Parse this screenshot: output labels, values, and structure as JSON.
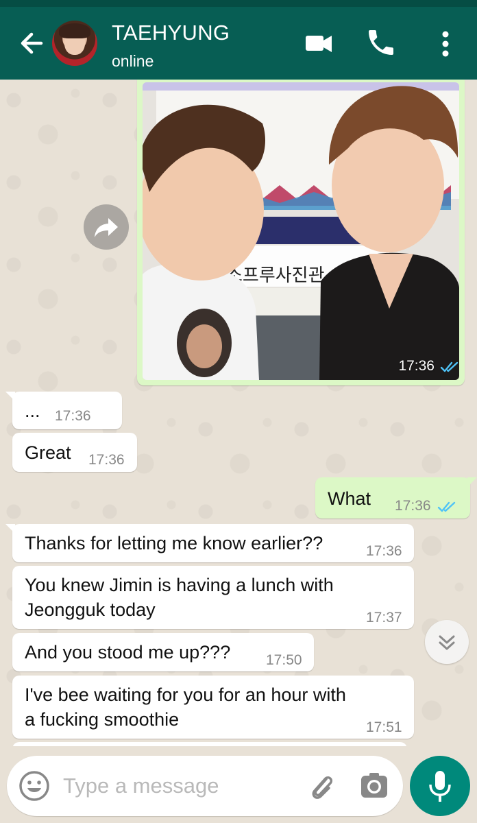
{
  "header": {
    "contact_name": "TAEHYUNG",
    "status": "online",
    "back_icon": "arrow-left-icon",
    "video_icon": "video-camera-icon",
    "phone_icon": "phone-icon",
    "menu_icon": "more-vert-icon"
  },
  "messages": [
    {
      "dir": "out",
      "type": "photo",
      "time": "17:36",
      "read": true
    },
    {
      "dir": "in",
      "text": "...",
      "time": "17:36"
    },
    {
      "dir": "in",
      "text": "Great",
      "time": "17:36"
    },
    {
      "dir": "out",
      "text": "What",
      "time": "17:36",
      "read": true
    },
    {
      "dir": "in",
      "text": "Thanks for letting me know earlier??",
      "time": "17:36"
    },
    {
      "dir": "in",
      "text": "You knew Jimin is having a lunch with\nJeongguk today",
      "time": "17:37"
    },
    {
      "dir": "in",
      "text": "And you stood me up???",
      "time": "17:50"
    },
    {
      "dir": "in",
      "text": "I've bee waiting for you for an hour with\na fucking smoothie",
      "time": "17:51"
    }
  ],
  "photo": {
    "sign_text": "소프루사진관"
  },
  "composer": {
    "placeholder": "Type a message",
    "emoji_icon": "emoji-icon",
    "attach_icon": "paperclip-icon",
    "camera_icon": "camera-icon",
    "mic_icon": "mic-icon"
  },
  "colors": {
    "header": "#075e54",
    "outgoing_bubble": "#dcf8c6",
    "incoming_bubble": "#ffffff",
    "read_tick": "#4fc3f7",
    "mic_button": "#00897b"
  }
}
